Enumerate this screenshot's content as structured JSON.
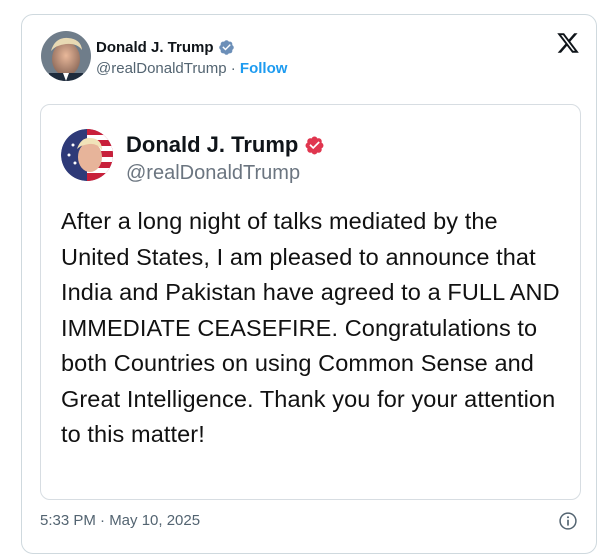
{
  "tweet": {
    "author_name": "Donald J. Trump",
    "handle": "@realDonaldTrump",
    "separator": " · ",
    "follow_label": "Follow",
    "verified_icon": "verified-badge-icon",
    "platform_icon": "x-logo-icon",
    "timestamp": "5:33 PM · May 10, 2025",
    "info_icon": "info-icon"
  },
  "embedded_post": {
    "author_name": "Donald J. Trump",
    "handle": "@realDonaldTrump",
    "verified_icon": "truth-verified-badge-icon",
    "text": "After a long night of talks mediated by the United States, I am pleased to announce that India and Pakistan have agreed to a FULL AND IMMEDIATE CEASEFIRE. Congratulations to both Countries on using Common Sense and Great Intelligence. Thank you for your attention to this matter!"
  },
  "colors": {
    "text": "#0f1419",
    "secondary_text": "#536471",
    "link": "#1d9bf0",
    "border": "#cfd9de",
    "verified_blue": "#6c8fb8",
    "truth_badge_red": "#e0364f"
  }
}
